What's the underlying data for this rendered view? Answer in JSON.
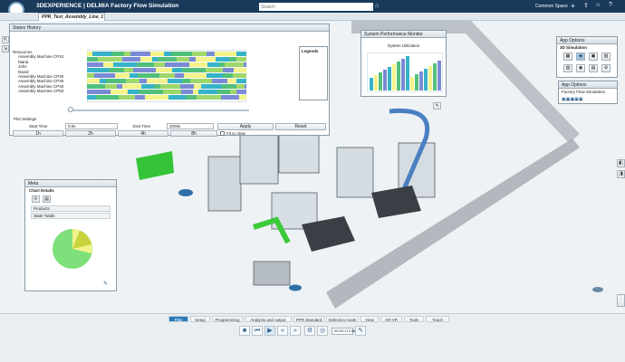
{
  "app": {
    "brand": "3DEXPERIENCE | DELMIA Factory Flow Simulation",
    "search_placeholder": "Search",
    "user_space": "Common Space",
    "document_tab": "PPR_Test_Assembly_Line_1"
  },
  "states_history": {
    "title": "States History",
    "tree": [
      {
        "label": "Resources"
      },
      {
        "label": "Assembly Machine CP10"
      },
      {
        "label": "Maria"
      },
      {
        "label": "John"
      },
      {
        "label": "David"
      },
      {
        "label": "Assembly Machine CP20"
      },
      {
        "label": "Assembly Machine CP30"
      },
      {
        "label": "Assembly Machine CP40"
      },
      {
        "label": "Assembly Machine CP50"
      }
    ],
    "legend_label": "Legends",
    "axis_start": "",
    "axis_end": "",
    "plot_settings": {
      "title": "Plot Settings",
      "start_time_label": "Start Time",
      "start_time_value": "0.0s",
      "end_time_label": "End Time",
      "end_time_value": "4000s",
      "apply_label": "Apply",
      "reset_label": "Reset",
      "fit_label": "Fit to View",
      "zoom_buttons": [
        "1h",
        "2h",
        "4h",
        "8h"
      ]
    }
  },
  "performance_monitor": {
    "title": "System Performance Monitor",
    "subtitle": "System Utilization"
  },
  "meta_panel": {
    "title": "Meta",
    "section": "Chart Details",
    "rows": [
      {
        "label": "Products"
      },
      {
        "label": "State Totals"
      }
    ]
  },
  "app_options": {
    "title": "App Options",
    "section": "3D Simulation",
    "sub_title": "App Options",
    "factory_label": "Factory Flow Simulation"
  },
  "bottom_tabs": [
    "Play",
    "Setup",
    "Programming",
    "Analysis and output",
    "PPR Standard",
    "Selection mode",
    "View",
    "AR-VR",
    "Tools",
    "Touch"
  ],
  "play_controls": {
    "time": "00:00:174.96"
  },
  "colors": {
    "header": "#1a3a5c",
    "accent": "#2b7bb9",
    "pie_green": "#7ee07a",
    "pie_yellow": "#f3f38a",
    "pie_olive": "#c8d23c"
  }
}
